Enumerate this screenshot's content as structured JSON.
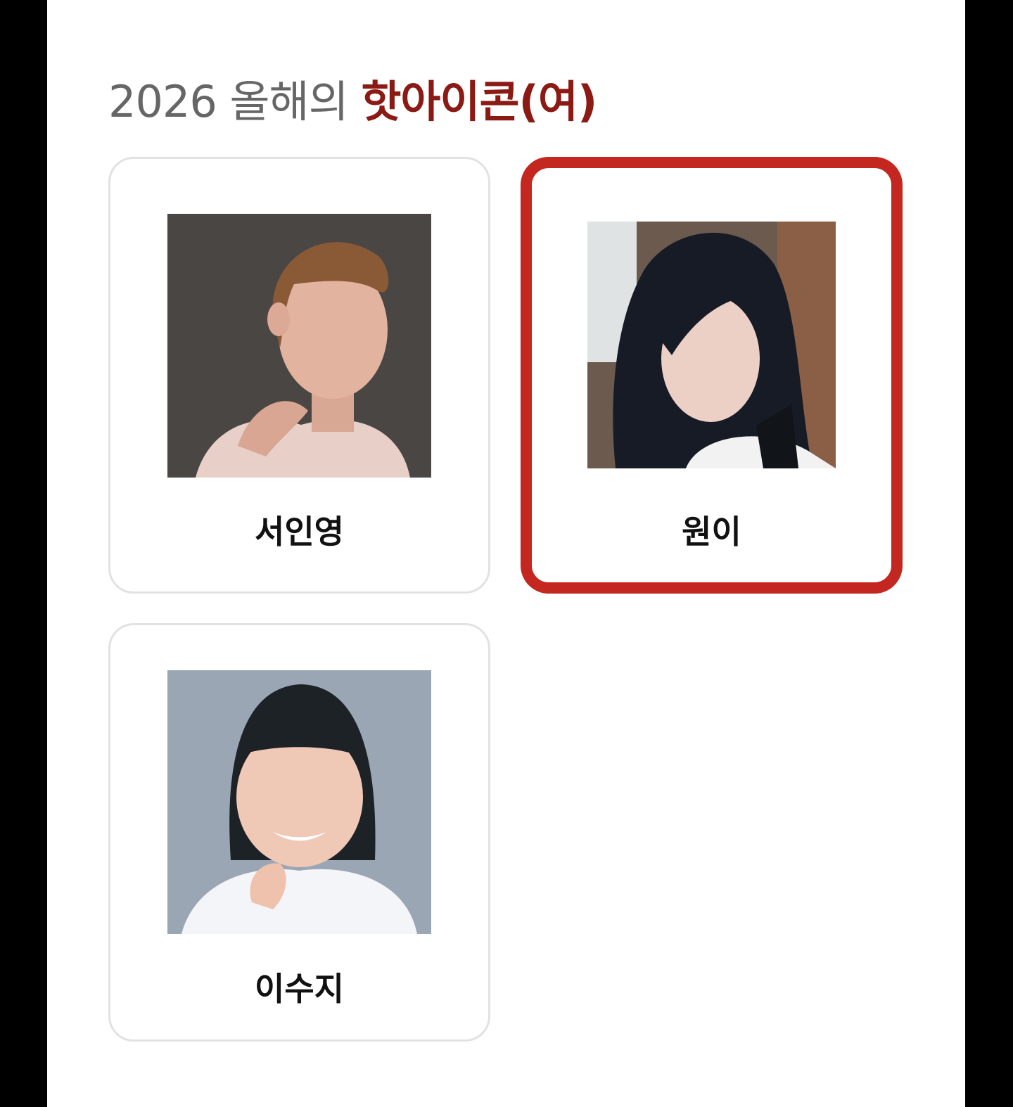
{
  "section": {
    "title_prefix": "2026 올해의 ",
    "title_highlight": "핫아이콘(여)"
  },
  "colors": {
    "accent": "#8b1a14",
    "selected_border": "#c4271f",
    "card_border": "#e2e2e2"
  },
  "candidates": [
    {
      "name": "서인영",
      "selected": false
    },
    {
      "name": "원이",
      "selected": true
    },
    {
      "name": "이수지",
      "selected": false
    }
  ]
}
